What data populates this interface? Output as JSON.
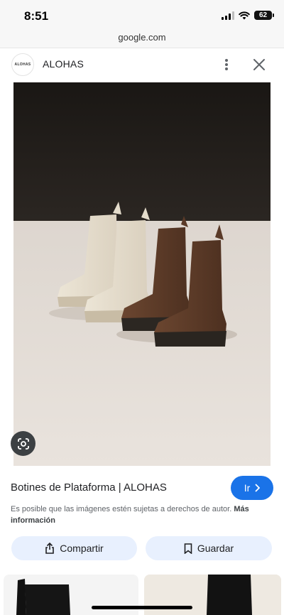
{
  "status_bar": {
    "time": "8:51",
    "battery": "62"
  },
  "url_bar": {
    "domain": "google.com"
  },
  "site": {
    "logo_text": "ALOHAS",
    "name": "ALOHAS"
  },
  "product": {
    "title": "Botines de Plataforma | ALOHAS",
    "go_label": "Ir",
    "copyright_text": "Es posible que las imágenes estén sujetas a derechos de autor.",
    "more_info_label": "Más información"
  },
  "actions": {
    "share_label": "Compartir",
    "save_label": "Guardar"
  },
  "icons": {
    "more": "more-vert-icon",
    "close": "close-icon",
    "lens": "google-lens-icon",
    "share": "share-icon",
    "save": "bookmark-icon",
    "go": "chevron-right-icon"
  },
  "colors": {
    "primary": "#1a73e8",
    "action_bg": "#e8f0fe",
    "text": "#202124",
    "secondary_text": "#5f6368"
  }
}
